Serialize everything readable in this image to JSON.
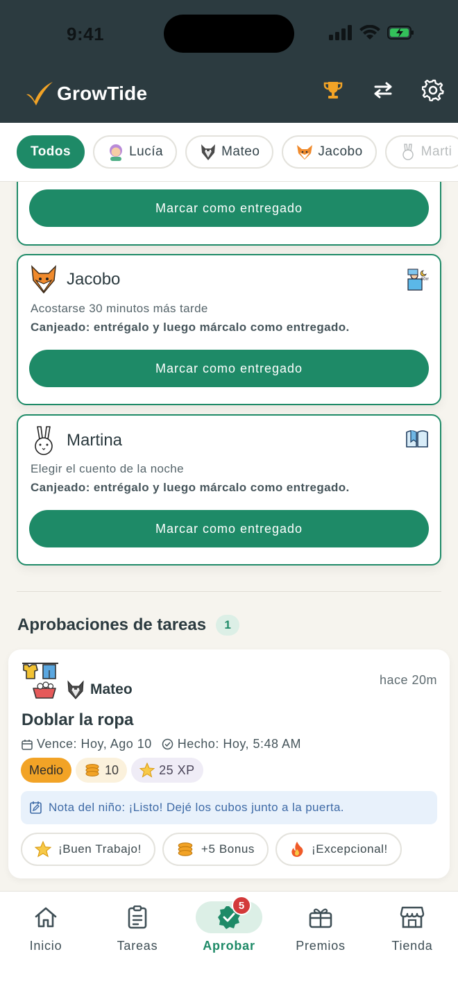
{
  "status": {
    "time": "9:41"
  },
  "app": {
    "name": "GrowTide"
  },
  "filters": [
    {
      "label": "Todos",
      "active": true
    },
    {
      "label": "Lucía"
    },
    {
      "label": "Mateo"
    },
    {
      "label": "Jacobo"
    },
    {
      "label": "Marti"
    }
  ],
  "reward_cards": [
    {
      "button": "Marcar como entregado"
    },
    {
      "child": "Jacobo",
      "reward": "Acostarse 30 minutos más tarde",
      "status": "Canjeado: entrégalo y luego márcalo como entregado.",
      "button": "Marcar como entregado"
    },
    {
      "child": "Martina",
      "reward": "Elegir el cuento de la noche",
      "status": "Canjeado: entrégalo y luego márcalo como entregado.",
      "button": "Marcar como entregado"
    }
  ],
  "task_section": {
    "title": "Aprobaciones de tareas",
    "count": "1"
  },
  "task": {
    "child": "Mateo",
    "time_ago": "hace 20m",
    "title": "Doblar la ropa",
    "due": "Vence: Hoy, Ago 10",
    "done": "Hecho: Hoy, 5:48 AM",
    "difficulty": "Medio",
    "coins": "10",
    "xp": "25 XP",
    "note": "Nota del niño: ¡Listo! Dejé los cubos junto a la puerta.",
    "praise": [
      "¡Buen Trabajo!",
      "+5 Bonus",
      "¡Excepcional!"
    ]
  },
  "nav": [
    {
      "label": "Inicio",
      "icon": "home-icon"
    },
    {
      "label": "Tareas",
      "icon": "clipboard-icon"
    },
    {
      "label": "Aprobar",
      "icon": "verified-badge-icon",
      "badge": "5",
      "active": true
    },
    {
      "label": "Premios",
      "icon": "gift-icon"
    },
    {
      "label": "Tienda",
      "icon": "store-icon"
    }
  ],
  "colors": {
    "brand": "#1e8a67",
    "header": "#2c3b40",
    "accent": "#f2a326"
  }
}
